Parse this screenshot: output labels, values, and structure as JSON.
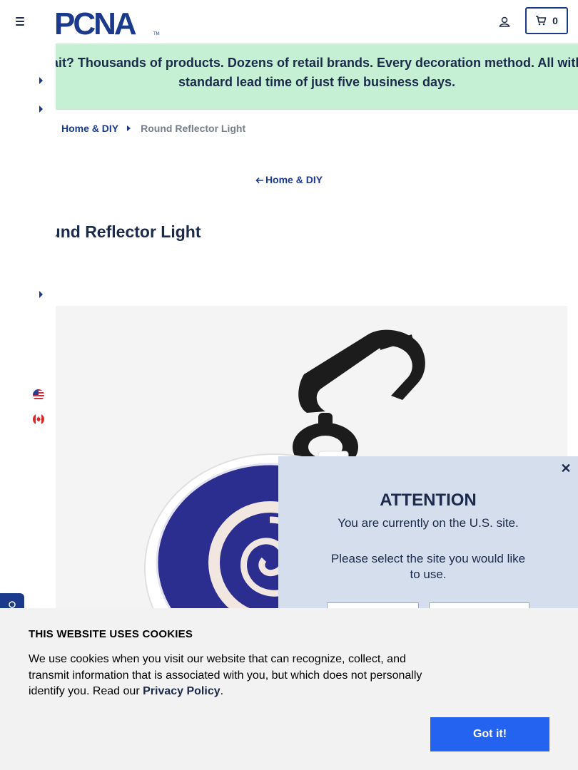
{
  "header": {
    "logo_text": "PCNA",
    "logo_tm": "TM",
    "cart_count": "0",
    "brand_color": "#1b3a8c"
  },
  "banner": {
    "text": "Wait? Thousands of products. Dozens of retail brands. Every decoration method. All with a standard lead time of just five business days.",
    "background": "#c6f0d4"
  },
  "breadcrumb": {
    "items": [
      {
        "label": "Home & DIY"
      },
      {
        "label": "Round Reflector Light"
      }
    ]
  },
  "back_link": {
    "label": "Home & DIY"
  },
  "product": {
    "title": "Round Reflector Light"
  },
  "country_selector": {
    "options": [
      "us-flag-icon",
      "ca-flag-icon"
    ]
  },
  "modal": {
    "title": "ATTENTION",
    "current_site": "You are currently on the U.S. site.",
    "prompt": "Please select the site you would like to use."
  },
  "cookie_banner": {
    "title": "THIS WEBSITE USES COOKIES",
    "text_before": "We use cookies when you visit our website that can recognize, collect, and transmit information that is associated with you, but which does not personally identify you. Read our ",
    "link_label": "Privacy Policy",
    "text_after": ".",
    "accept_label": "Got it!",
    "accept_color": "#2463f0"
  }
}
